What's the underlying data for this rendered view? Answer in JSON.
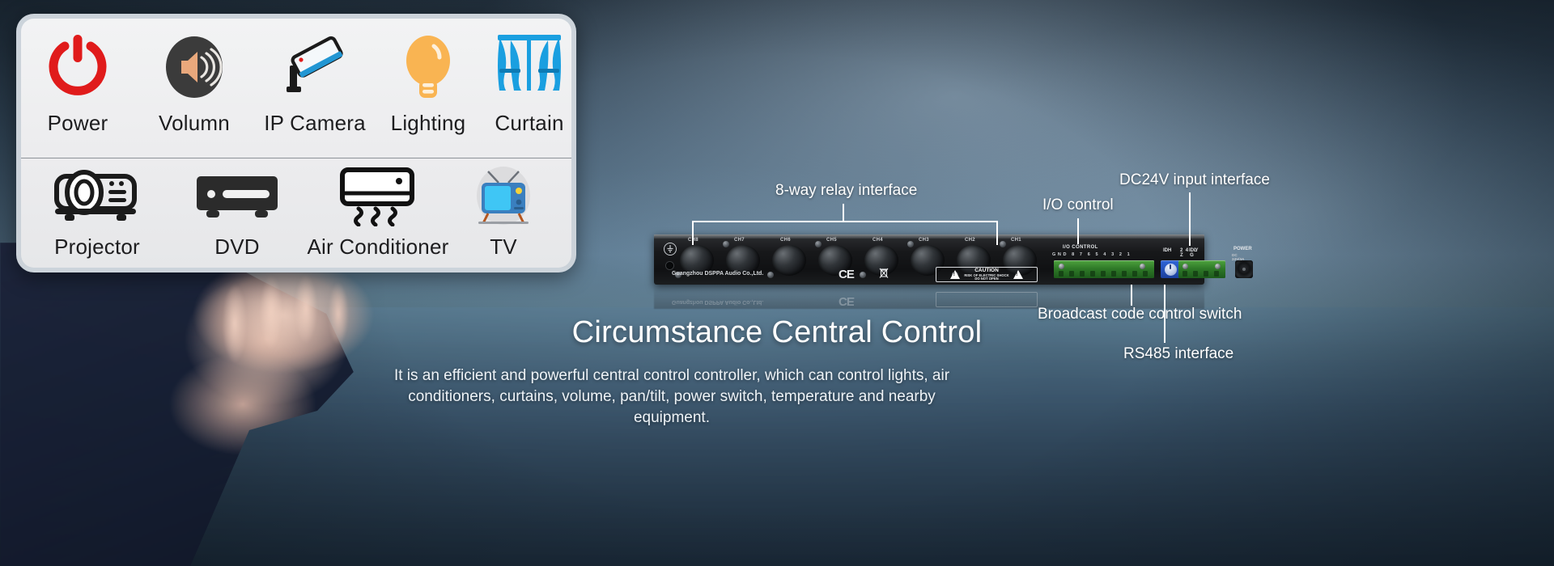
{
  "panel": {
    "rows": [
      {
        "items": [
          {
            "label": "Power",
            "icon": "power-icon",
            "color": "#e01b1b"
          },
          {
            "label": "Volumn",
            "icon": "volume-icon",
            "color": "#3b3b3b"
          },
          {
            "label": "IP Camera",
            "icon": "ip-camera-icon",
            "color": "#1b1b1b"
          },
          {
            "label": "Lighting",
            "icon": "light-bulb-icon",
            "color": "#f9b452"
          },
          {
            "label": "Curtain",
            "icon": "curtain-icon",
            "color": "#1a9fe0"
          }
        ]
      },
      {
        "items": [
          {
            "label": "Projector",
            "icon": "projector-icon",
            "color": "#1b1b1b"
          },
          {
            "label": "DVD",
            "icon": "dvd-player-icon",
            "color": "#2b2b2b"
          },
          {
            "label": "Air Conditioner",
            "icon": "air-conditioner-icon",
            "color": "#111111"
          },
          {
            "label": "TV",
            "icon": "tv-icon",
            "color": "#3a7fbf"
          }
        ]
      }
    ]
  },
  "device": {
    "channels": [
      "CH8",
      "CH7",
      "CH6",
      "CH5",
      "CH4",
      "CH3",
      "CH2",
      "CH1"
    ],
    "brand": "Guangzhou DSPPA Audio Co.,Ltd.",
    "ce_mark": "CE",
    "caution_title": "CAUTION",
    "caution_line1": "RISK OF ELECTRIC SHOCK",
    "caution_line2": "DO NOT OPEN",
    "io_control_label": "I/O CONTROL",
    "io_pin_labels": "GND 8 7 6 5 4 3 2 1",
    "dip_labels": [
      "IDH",
      "IDL"
    ],
    "rs485_labels": "24 Y Z G",
    "power_label": "POWER",
    "power_spec": "DC 24V/3A"
  },
  "callouts": {
    "relay": "8-way relay interface",
    "io": "I/O control",
    "dc24v": "DC24V input interface",
    "broadcast": "Broadcast code control switch",
    "rs485": "RS485 interface"
  },
  "headline": "Circumstance Central Control",
  "description": "It is an efficient and powerful central control controller, which can control lights, air conditioners, curtains, volume, pan/tilt, power switch, temperature and nearby equipment.",
  "colors": {
    "accent_red": "#e01b1b",
    "accent_amber": "#f9b452",
    "accent_blue": "#1a9fe0",
    "terminal_green": "#3f8f33",
    "dip_blue": "#2453b8",
    "callout_white": "#ffffff"
  }
}
